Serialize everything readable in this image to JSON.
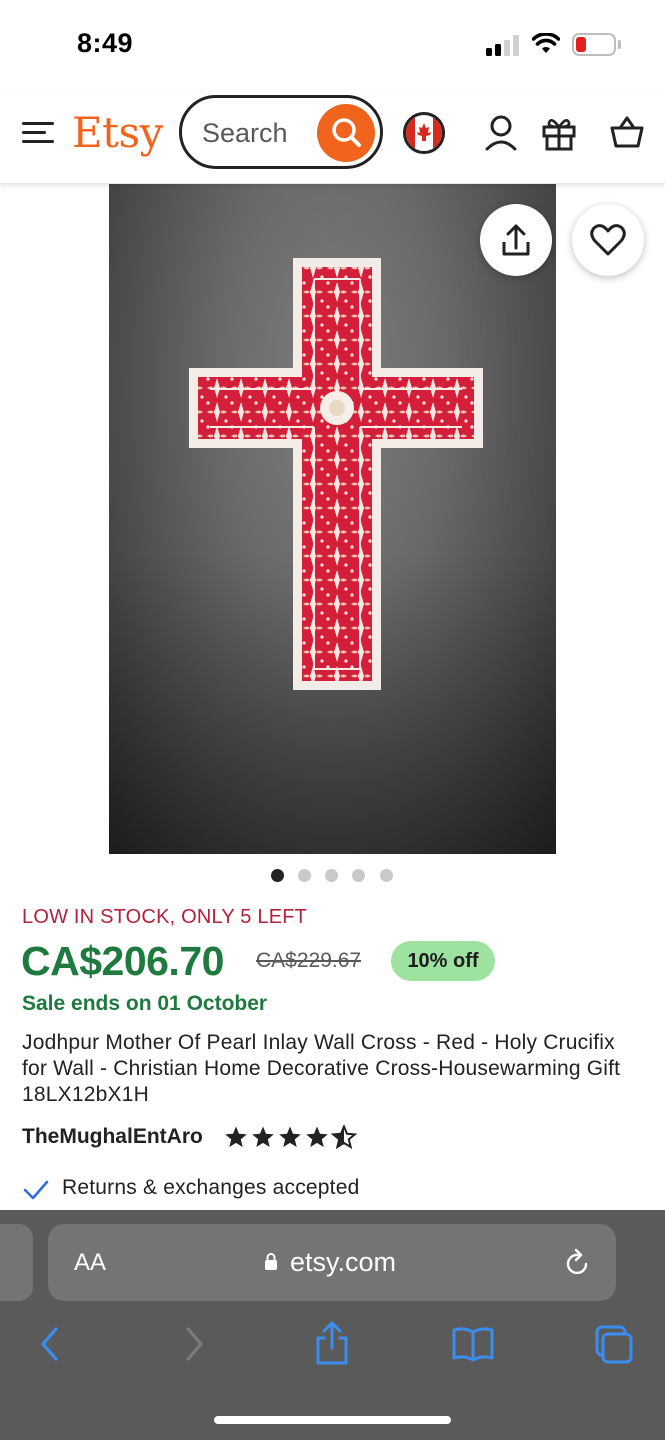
{
  "status_bar": {
    "time": "8:49",
    "battery_color": "#e32020"
  },
  "header": {
    "logo": "Etsy",
    "search_placeholder": "Search",
    "brand_color": "#f1641e",
    "icons": [
      "menu-icon",
      "search-icon",
      "canada-flag-icon",
      "account-icon",
      "gift-icon",
      "cart-icon"
    ]
  },
  "gallery": {
    "image_alt": "Red mother of pearl inlay wall cross",
    "image_count": 5,
    "active_index": 0,
    "actions": [
      "share-icon",
      "favorite-heart-icon"
    ]
  },
  "product": {
    "stock_notice": "LOW IN STOCK, ONLY 5 LEFT",
    "price": "CA$206.70",
    "original_price": "CA$229.67",
    "discount": "10% off",
    "sale_ends": "Sale ends on 01 October",
    "title": "Jodhpur Mother Of Pearl Inlay Wall Cross - Red - Holy Crucifix for Wall - Christian Home Decorative Cross-Housewarming Gift 18LX12bX1H",
    "shop_name": "TheMughalEntAro",
    "rating": 4.5,
    "returns": "Returns & exchanges accepted",
    "price_color": "#1e7a3e",
    "stock_color": "#b3213b",
    "discount_bg": "#9ee29f"
  },
  "browser": {
    "aa_label": "AA",
    "url": "etsy.com",
    "toolbar": [
      "back-icon",
      "forward-icon",
      "share-icon",
      "bookmarks-icon",
      "tabs-icon"
    ]
  }
}
